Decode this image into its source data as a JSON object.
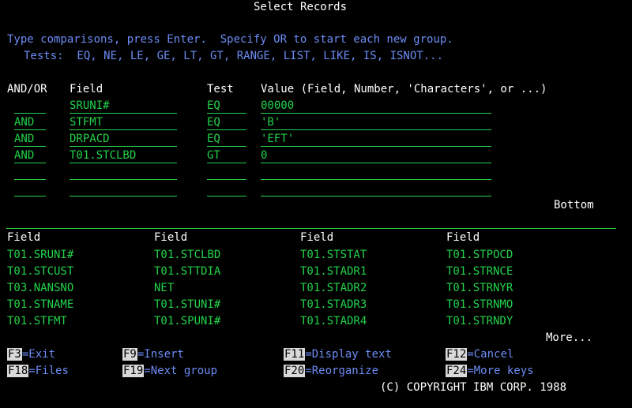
{
  "header": {
    "title": "Select Records"
  },
  "instructions": {
    "line1": "Type comparisons, press Enter.  Specify OR to start each new group.",
    "line2": "Tests:  EQ, NE, LE, GE, LT, GT, RANGE, LIST, LIKE, IS, ISNOT..."
  },
  "table_headers": {
    "andor": "AND/OR",
    "field": "Field",
    "test": "Test",
    "value": "Value (Field, Number, 'Characters', or ...)"
  },
  "rows": [
    {
      "andor": "",
      "field": "SRUNI#",
      "test": "EQ",
      "value": "00000"
    },
    {
      "andor": "AND",
      "field": "STFMT",
      "test": "EQ",
      "value": "'B'"
    },
    {
      "andor": "AND",
      "field": "DRPACD",
      "test": "EQ",
      "value": "'EFT'"
    },
    {
      "andor": "AND",
      "field": "T01.STCLBD",
      "test": "GT",
      "value": "0"
    },
    {
      "andor": "",
      "field": "",
      "test": "",
      "value": ""
    },
    {
      "andor": "",
      "field": "",
      "test": "",
      "value": ""
    }
  ],
  "bottom_label": "Bottom",
  "field_list": {
    "header": "Field",
    "columns": [
      [
        "T01.SRUNI#",
        "T01.STCUST",
        "T03.NANSNO",
        "T01.STNAME",
        "T01.STFMT"
      ],
      [
        "T01.STCLBD",
        "T01.STTDIA",
        "NET",
        "T01.STUNI#",
        "T01.SPUNI#"
      ],
      [
        "T01.STSTAT",
        "T01.STADR1",
        "T01.STADR2",
        "T01.STADR3",
        "T01.STADR4"
      ],
      [
        "T01.STPOCD",
        "T01.STRNCE",
        "T01.STRNYR",
        "T01.STRNMO",
        "T01.STRNDY"
      ]
    ]
  },
  "more_label": "More...",
  "function_keys": [
    {
      "key": "F3",
      "label": "=Exit"
    },
    {
      "key": "F9",
      "label": "=Insert"
    },
    {
      "key": "F11",
      "label": "=Display text"
    },
    {
      "key": "F12",
      "label": "=Cancel"
    },
    {
      "key": "F18",
      "label": "=Files"
    },
    {
      "key": "F19",
      "label": "=Next group"
    },
    {
      "key": "F20",
      "label": "=Reorganize"
    },
    {
      "key": "F24",
      "label": "=More keys"
    }
  ],
  "copyright": "(C) COPYRIGHT IBM CORP. 1988",
  "colors": {
    "background": "#000000",
    "green": "#22d24a",
    "blue": "#6c8cf4",
    "white": "#ffffff",
    "key_bg": "#d9d9d9"
  }
}
